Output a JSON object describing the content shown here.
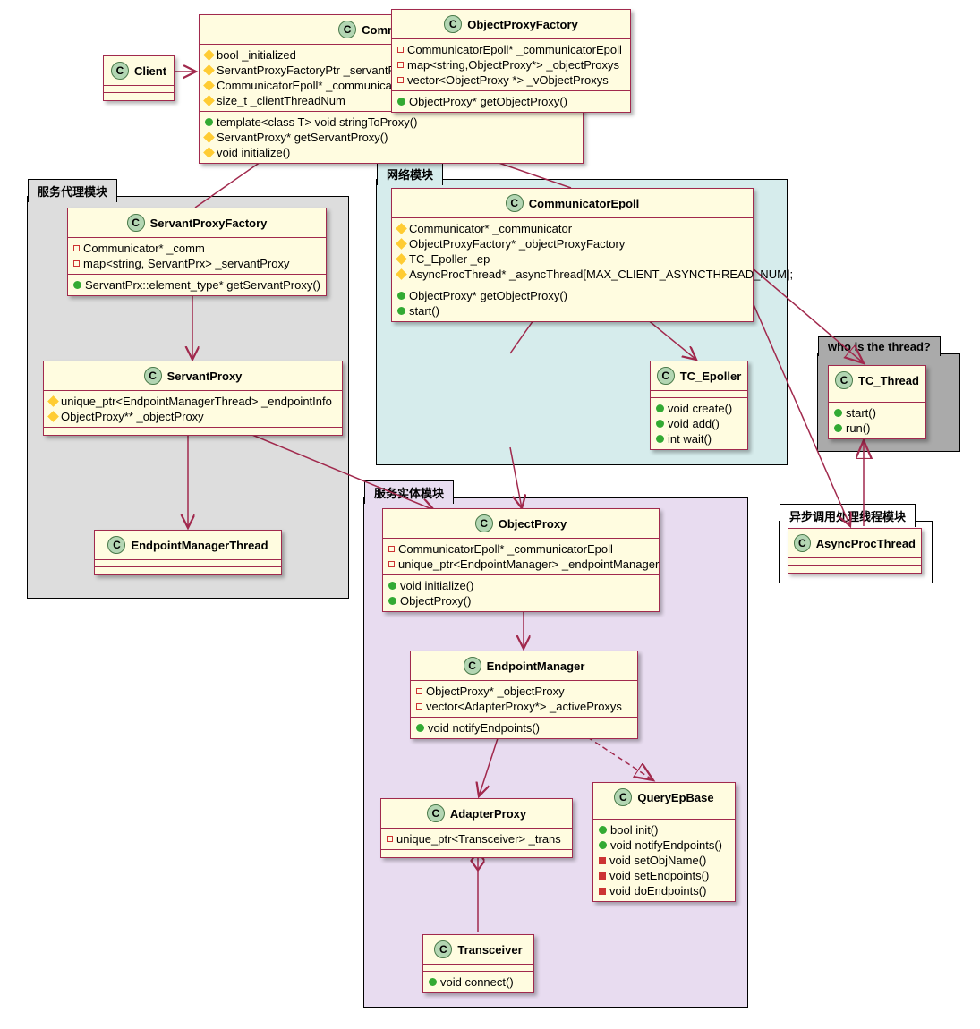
{
  "chart_data": {
    "type": "uml-class-diagram",
    "packages": [
      {
        "name": "服务代理模块",
        "classes": [
          "ServantProxyFactory",
          "ServantProxy",
          "EndpointManagerThread"
        ]
      },
      {
        "name": "网络模块",
        "classes": [
          "CommunicatorEpoll",
          "ObjectProxyFactory",
          "TC_Epoller"
        ]
      },
      {
        "name": "服务实体模块",
        "classes": [
          "ObjectProxy",
          "EndpointManager",
          "AdapterProxy",
          "QueryEpBase",
          "Transceiver"
        ]
      },
      {
        "name": "who is the thread?",
        "classes": [
          "TC_Thread"
        ]
      },
      {
        "name": "异步调用处理线程模块",
        "classes": [
          "AsyncProcThread"
        ]
      }
    ],
    "classes": {
      "Client": {
        "stereotype": "C",
        "attributes": [],
        "operations": []
      },
      "Communicator": {
        "stereotype": "C",
        "attributes": [
          {
            "vis": "protected",
            "text": "bool _initialized"
          },
          {
            "vis": "protected",
            "text": "ServantProxyFactoryPtr _servantProxyFactory"
          },
          {
            "vis": "protected",
            "text": "CommunicatorEpoll* _communicatorEpoll[MAX_CLIENT_THREAD_NUM]"
          },
          {
            "vis": "protected",
            "text": "size_t _clientThreadNum"
          }
        ],
        "operations": [
          {
            "vis": "public",
            "text": "template<class T> void stringToProxy()"
          },
          {
            "vis": "protected",
            "text": "ServantProxy* getServantProxy()"
          },
          {
            "vis": "protected",
            "text": "void initialize()"
          }
        ]
      },
      "ServantProxyFactory": {
        "stereotype": "C",
        "attributes": [
          {
            "vis": "private",
            "text": "Communicator* _comm"
          },
          {
            "vis": "private",
            "text": "map<string, ServantPrx> _servantProxy"
          }
        ],
        "operations": [
          {
            "vis": "public",
            "text": "ServantPrx::element_type* getServantProxy()"
          }
        ]
      },
      "ServantProxy": {
        "stereotype": "C",
        "attributes": [
          {
            "vis": "protected",
            "text": "unique_ptr<EndpointManagerThread> _endpointInfo"
          },
          {
            "vis": "protected",
            "text": "ObjectProxy** _objectProxy"
          }
        ],
        "operations": []
      },
      "EndpointManagerThread": {
        "stereotype": "C",
        "attributes": [],
        "operations": []
      },
      "CommunicatorEpoll": {
        "stereotype": "C",
        "attributes": [
          {
            "vis": "protected",
            "text": "Communicator* _communicator"
          },
          {
            "vis": "protected",
            "text": "ObjectProxyFactory* _objectProxyFactory"
          },
          {
            "vis": "protected",
            "text": "TC_Epoller _ep"
          },
          {
            "vis": "protected",
            "text": "AsyncProcThread* _asyncThread[MAX_CLIENT_ASYNCTHREAD_NUM];"
          }
        ],
        "operations": [
          {
            "vis": "public",
            "text": "ObjectProxy* getObjectProxy()"
          },
          {
            "vis": "public",
            "text": "start()"
          }
        ]
      },
      "ObjectProxyFactory": {
        "stereotype": "C",
        "attributes": [
          {
            "vis": "private",
            "text": "CommunicatorEpoll* _communicatorEpoll"
          },
          {
            "vis": "private",
            "text": "map<string,ObjectProxy*> _objectProxys"
          },
          {
            "vis": "private",
            "text": "vector<ObjectProxy *> _vObjectProxys"
          }
        ],
        "operations": [
          {
            "vis": "public",
            "text": "ObjectProxy* getObjectProxy()"
          }
        ]
      },
      "TC_Epoller": {
        "stereotype": "C",
        "attributes": [],
        "operations": [
          {
            "vis": "public",
            "text": "void create()"
          },
          {
            "vis": "public",
            "text": "void add()"
          },
          {
            "vis": "public",
            "text": "int wait()"
          }
        ]
      },
      "TC_Thread": {
        "stereotype": "C",
        "attributes": [],
        "operations": [
          {
            "vis": "public",
            "text": "start()"
          },
          {
            "vis": "public",
            "text": "run()"
          }
        ]
      },
      "AsyncProcThread": {
        "stereotype": "C",
        "attributes": [],
        "operations": []
      },
      "ObjectProxy": {
        "stereotype": "C",
        "attributes": [
          {
            "vis": "private",
            "text": "CommunicatorEpoll* _communicatorEpoll"
          },
          {
            "vis": "private",
            "text": "unique_ptr<EndpointManager> _endpointManager"
          }
        ],
        "operations": [
          {
            "vis": "public",
            "text": "void initialize()"
          },
          {
            "vis": "public",
            "text": "ObjectProxy()"
          }
        ]
      },
      "EndpointManager": {
        "stereotype": "C",
        "attributes": [
          {
            "vis": "private",
            "text": "ObjectProxy* _objectProxy"
          },
          {
            "vis": "private",
            "text": "vector<AdapterProxy*> _activeProxys"
          }
        ],
        "operations": [
          {
            "vis": "public",
            "text": "void notifyEndpoints()"
          }
        ]
      },
      "AdapterProxy": {
        "stereotype": "C",
        "attributes": [
          {
            "vis": "private",
            "text": "unique_ptr<Transceiver> _trans"
          }
        ],
        "operations": []
      },
      "QueryEpBase": {
        "stereotype": "C",
        "attributes": [],
        "operations": [
          {
            "vis": "public",
            "text": "bool init()"
          },
          {
            "vis": "public",
            "text": "void notifyEndpoints()"
          },
          {
            "vis": "private-impl",
            "text": "void setObjName()"
          },
          {
            "vis": "private-impl",
            "text": "void setEndpoints()"
          },
          {
            "vis": "private-impl",
            "text": "void doEndpoints()"
          }
        ]
      },
      "Transceiver": {
        "stereotype": "C",
        "attributes": [],
        "operations": [
          {
            "vis": "public",
            "text": "void connect()"
          }
        ]
      }
    },
    "relations": [
      {
        "from": "Client",
        "to": "Communicator",
        "type": "association-arrow"
      },
      {
        "from": "Communicator",
        "to": "ServantProxyFactory",
        "type": "aggregation"
      },
      {
        "from": "Communicator",
        "to": "CommunicatorEpoll",
        "type": "aggregation"
      },
      {
        "from": "ServantProxyFactory",
        "to": "ServantProxy",
        "type": "association-arrow"
      },
      {
        "from": "ServantProxy",
        "to": "EndpointManagerThread",
        "type": "association-arrow"
      },
      {
        "from": "ServantProxy",
        "to": "ObjectProxy",
        "type": "association-arrow"
      },
      {
        "from": "CommunicatorEpoll",
        "to": "ObjectProxyFactory",
        "type": "aggregation"
      },
      {
        "from": "CommunicatorEpoll",
        "to": "TC_Epoller",
        "type": "association-arrow"
      },
      {
        "from": "CommunicatorEpoll",
        "to": "AsyncProcThread",
        "type": "association-arrow"
      },
      {
        "from": "CommunicatorEpoll",
        "to": "TC_Thread",
        "type": "generalization"
      },
      {
        "from": "ObjectProxyFactory",
        "to": "ObjectProxy",
        "type": "association-arrow"
      },
      {
        "from": "ObjectProxy",
        "to": "EndpointManager",
        "type": "association-both"
      },
      {
        "from": "EndpointManager",
        "to": "AdapterProxy",
        "type": "association-arrow"
      },
      {
        "from": "EndpointManager",
        "to": "QueryEpBase",
        "type": "realization"
      },
      {
        "from": "AdapterProxy",
        "to": "Transceiver",
        "type": "aggregation"
      },
      {
        "from": "AsyncProcThread",
        "to": "TC_Thread",
        "type": "generalization"
      }
    ]
  },
  "packages": {
    "proxy": "服务代理模块",
    "net": "网络模块",
    "entity": "服务实体模块",
    "thread": "who is the thread?",
    "async": "异步调用处理线程模块"
  },
  "classes": {
    "Client": {
      "name": "Client"
    },
    "Communicator": {
      "name": "Communicator",
      "a0": "bool _initialized",
      "a1": "ServantProxyFactoryPtr _servantProxyFactory",
      "a2": "CommunicatorEpoll* _communicatorEpoll[MAX_CLIENT_THREAD_NUM]",
      "a3": "size_t _clientThreadNum",
      "o0": "template<class T> void stringToProxy()",
      "o1": "ServantProxy* getServantProxy()",
      "o2": "void initialize()"
    },
    "ServantProxyFactory": {
      "name": "ServantProxyFactory",
      "a0": "Communicator* _comm",
      "a1": "map<string, ServantPrx> _servantProxy",
      "o0": "ServantPrx::element_type* getServantProxy()"
    },
    "ServantProxy": {
      "name": "ServantProxy",
      "a0": "unique_ptr<EndpointManagerThread> _endpointInfo",
      "a1": "ObjectProxy** _objectProxy"
    },
    "EndpointManagerThread": {
      "name": "EndpointManagerThread"
    },
    "CommunicatorEpoll": {
      "name": "CommunicatorEpoll",
      "a0": "Communicator* _communicator",
      "a1": "ObjectProxyFactory* _objectProxyFactory",
      "a2": "TC_Epoller _ep",
      "a3": "AsyncProcThread* _asyncThread[MAX_CLIENT_ASYNCTHREAD_NUM];",
      "o0": "ObjectProxy* getObjectProxy()",
      "o1": "start()"
    },
    "ObjectProxyFactory": {
      "name": "ObjectProxyFactory",
      "a0": "CommunicatorEpoll* _communicatorEpoll",
      "a1": "map<string,ObjectProxy*> _objectProxys",
      "a2": "vector<ObjectProxy *> _vObjectProxys",
      "o0": "ObjectProxy* getObjectProxy()"
    },
    "TC_Epoller": {
      "name": "TC_Epoller",
      "o0": "void create()",
      "o1": "void add()",
      "o2": "int wait()"
    },
    "TC_Thread": {
      "name": "TC_Thread",
      "o0": "start()",
      "o1": "run()"
    },
    "AsyncProcThread": {
      "name": "AsyncProcThread"
    },
    "ObjectProxy": {
      "name": "ObjectProxy",
      "a0": "CommunicatorEpoll* _communicatorEpoll",
      "a1": "unique_ptr<EndpointManager> _endpointManager",
      "o0": "void initialize()",
      "o1": "ObjectProxy()"
    },
    "EndpointManager": {
      "name": "EndpointManager",
      "a0": "ObjectProxy* _objectProxy",
      "a1": "vector<AdapterProxy*> _activeProxys",
      "o0": "void notifyEndpoints()"
    },
    "AdapterProxy": {
      "name": "AdapterProxy",
      "a0": "unique_ptr<Transceiver> _trans"
    },
    "QueryEpBase": {
      "name": "QueryEpBase",
      "o0": "bool init()",
      "o1": "void notifyEndpoints()",
      "o2": "void setObjName()",
      "o3": "void setEndpoints()",
      "o4": "void doEndpoints()"
    },
    "Transceiver": {
      "name": "Transceiver",
      "o0": "void connect()"
    }
  }
}
